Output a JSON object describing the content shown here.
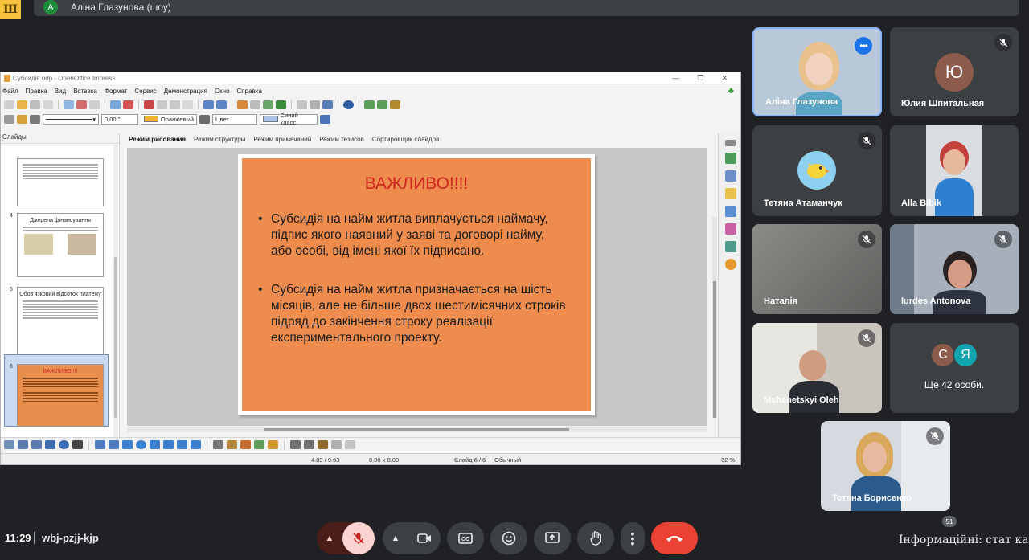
{
  "top": {
    "logo_letter": "Ш",
    "presenter_initial": "А",
    "presenter_label": "Аліна Глазунова (шоу)"
  },
  "impress": {
    "title": "Субсидія.odp - OpenOffice Impress",
    "menu": [
      "Файл",
      "Правка",
      "Вид",
      "Вставка",
      "Формат",
      "Сервис",
      "Демонстрация",
      "Окно",
      "Справка"
    ],
    "line_width": "0.00 \"",
    "fill_color_label": "Оранжевый",
    "color_mode": "Цвет",
    "line_color_label": "Синий класс.",
    "slides_panel_title": "Слайды",
    "tabs": [
      "Режим рисования",
      "Режим структуры",
      "Режим примечаний",
      "Режим тезисов",
      "Сортировщик слайдов"
    ],
    "thumbnails": [
      {
        "num": "",
        "title": ""
      },
      {
        "num": "4",
        "title": "Джерела фінансування"
      },
      {
        "num": "5",
        "title": "Обов'язковий відсоток платежу"
      },
      {
        "num": "6",
        "title": "ВАЖЛИВО!!!!"
      }
    ],
    "slide": {
      "title": "ВАЖЛИВО!!!!",
      "bullets": [
        "Субсидія на найм житла виплачується наймачу, підпис якого наявний у заяві та договорі найму, або особі, від імені якої їх підписано.",
        "Субсидія на найм житла призначається на шість місяців, але не більше двох шестимісячних строків підряд до закінчення строку реалізації експериментального проекту."
      ]
    },
    "status": {
      "position": "4.89 / 9.63",
      "size": "0.00 x 0.00",
      "slide_no": "Слайд 6 / 6",
      "layout": "Обычный",
      "zoom": "62 %"
    }
  },
  "participants": [
    {
      "name": "Аліна Глазунова",
      "type": "video"
    },
    {
      "name": "Юлия Шпитальная",
      "initial": "Ю",
      "type": "avatar"
    },
    {
      "name": "Тетяна Атаманчук",
      "type": "bird"
    },
    {
      "name": "Alla Bibik",
      "type": "video"
    },
    {
      "name": "Наталія",
      "type": "video"
    },
    {
      "name": "lurdes Antonova",
      "type": "video"
    },
    {
      "name": "Mshanetskyi Oleh",
      "type": "video"
    },
    {
      "name": "Ще 42 особи.",
      "initials": [
        "С",
        "Я"
      ],
      "type": "more"
    },
    {
      "name": "Тетяна Борисенко",
      "type": "video"
    }
  ],
  "bottom": {
    "time": "11:29",
    "meeting_code": "wbj-pzjj-kjp",
    "badge_count": "51",
    "overlay": "Інформаційні: стат катег"
  },
  "colors": {
    "meet_bg": "#202124",
    "tile_bg": "#3c4043",
    "slide_bg": "#ed8c4d",
    "slide_title": "#d0261f",
    "end_call": "#ea4335",
    "mic_off_bg": "#fad2cf",
    "active_speaker_border": "#8ab4f8"
  }
}
